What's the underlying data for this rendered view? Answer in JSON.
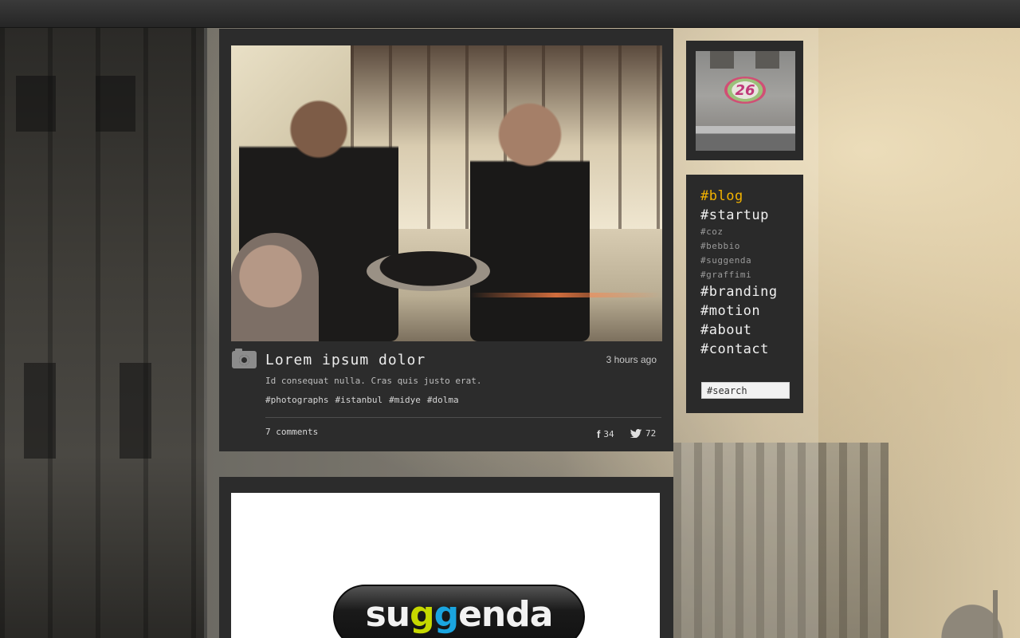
{
  "post": {
    "title": "Lorem ipsum dolor",
    "time": "3 hours ago",
    "text": "Id consequat nulla. Cras quis justo erat.",
    "tags": [
      "#photographs",
      "#istanbul",
      "#midye",
      "#dolma"
    ],
    "comments": "7 comments",
    "facebook_count": "34",
    "twitter_count": "72"
  },
  "post2": {
    "logo_text": {
      "part1": "su",
      "g1": "g",
      "g2": "g",
      "part2": "enda"
    }
  },
  "sidebar": {
    "avatar_graffiti": "26",
    "nav": [
      {
        "label": "#blog",
        "type": "main",
        "active": true
      },
      {
        "label": "#startup",
        "type": "main"
      },
      {
        "label": "#coz",
        "type": "sub"
      },
      {
        "label": "#bebbio",
        "type": "sub"
      },
      {
        "label": "#suggenda",
        "type": "sub"
      },
      {
        "label": "#graffimi",
        "type": "sub"
      },
      {
        "label": "#branding",
        "type": "main"
      },
      {
        "label": "#motion",
        "type": "main"
      },
      {
        "label": "#about",
        "type": "main"
      },
      {
        "label": "#contact",
        "type": "main"
      }
    ],
    "search_placeholder": "#search"
  },
  "colors": {
    "accent": "#f2b200",
    "panel": "#2c2c2c"
  }
}
